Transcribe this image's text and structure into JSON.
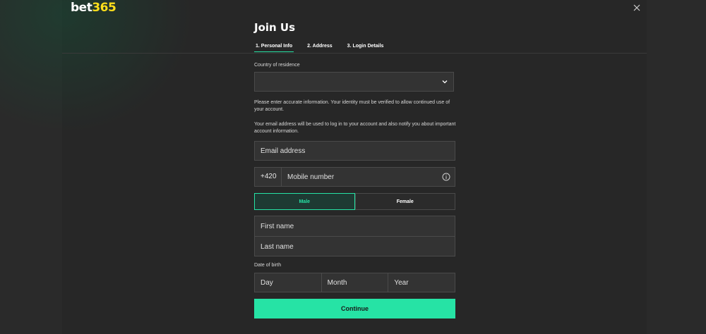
{
  "logo": {
    "bet": "bet",
    "num": "365"
  },
  "title": "Join Us",
  "tabs": [
    {
      "label": "1. Personal Info",
      "active": true
    },
    {
      "label": "2. Address",
      "active": false
    },
    {
      "label": "3. Login Details",
      "active": false
    }
  ],
  "country": {
    "label": "Country of residence",
    "value": ""
  },
  "info": {
    "identity": "Please enter accurate information. Your identity must be verified to allow continued use of your account.",
    "email": "Your email address will be used to log in to your account and also notify you about important account information."
  },
  "email": {
    "placeholder": "Email address"
  },
  "phone": {
    "prefix": "+420",
    "placeholder": "Mobile number"
  },
  "gender": {
    "male": "Male",
    "female": "Female",
    "selected": "male"
  },
  "name": {
    "first_placeholder": "First name",
    "last_placeholder": "Last name"
  },
  "dob": {
    "label": "Date of birth",
    "day": "Day",
    "month": "Month",
    "year": "Year"
  },
  "continue_label": "Continue",
  "colors": {
    "accent": "#26e3a5",
    "brand_yellow": "#ffdf1b",
    "background": "#272727"
  },
  "icons": {
    "close": "close-icon",
    "dropdown": "chevron-down-icon",
    "info": "info-icon"
  }
}
